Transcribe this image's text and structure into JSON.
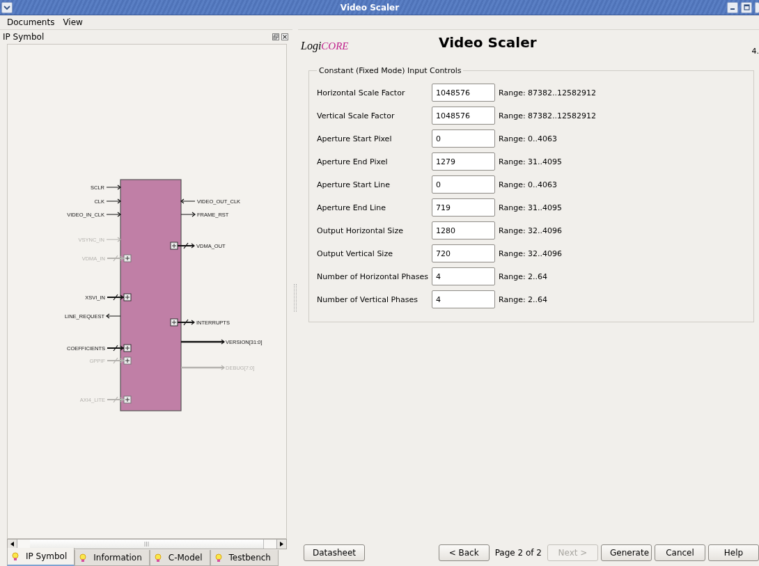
{
  "window": {
    "title": "Video Scaler"
  },
  "menu": [
    {
      "label": "Documents"
    },
    {
      "label": "View"
    }
  ],
  "left_panel": {
    "title": "IP Symbol",
    "symbol": {
      "left_pins": [
        {
          "label": "SCLR",
          "kind": "in",
          "disabled": false
        },
        {
          "label": "CLK",
          "kind": "in",
          "disabled": false
        },
        {
          "label": "VIDEO_IN_CLK",
          "kind": "in",
          "disabled": false
        },
        {
          "label": "VSYNC_IN",
          "kind": "in",
          "disabled": true
        },
        {
          "label": "VDMA_IN",
          "kind": "bus",
          "disabled": true
        },
        {
          "label": "XSVI_IN",
          "kind": "bus",
          "disabled": false
        },
        {
          "label": "LINE_REQUEST",
          "kind": "out",
          "disabled": false
        },
        {
          "label": "COEFFICIENTS",
          "kind": "bus",
          "disabled": false
        },
        {
          "label": "GPPIF",
          "kind": "bus",
          "disabled": true
        },
        {
          "label": "AXI4_LITE",
          "kind": "bus",
          "disabled": true
        }
      ],
      "right_pins": [
        {
          "label": "VIDEO_OUT_CLK",
          "kind": "in",
          "disabled": false
        },
        {
          "label": "FRAME_RST",
          "kind": "out",
          "disabled": false
        },
        {
          "label": "VDMA_OUT",
          "kind": "bus",
          "disabled": false
        },
        {
          "label": "INTERRUPTS",
          "kind": "bus",
          "disabled": false
        },
        {
          "label": "VERSION[31:0]",
          "kind": "wide",
          "disabled": false
        },
        {
          "label": "DEBUG[7:0]",
          "kind": "wide",
          "disabled": true
        }
      ]
    },
    "tabs": [
      {
        "label": "IP Symbol",
        "selected": true
      },
      {
        "label": "Information",
        "selected": false
      },
      {
        "label": "C-Model",
        "selected": false
      },
      {
        "label": "Testbench",
        "selected": false
      }
    ]
  },
  "header": {
    "logo": [
      "Logi",
      "CORE"
    ],
    "title": "Video Scaler",
    "version": "4."
  },
  "group": {
    "title": "Constant (Fixed Mode) Input Controls",
    "fields": [
      {
        "label": "Horizontal Scale Factor",
        "value": "1048576",
        "range": "Range: 87382..12582912"
      },
      {
        "label": "Vertical Scale Factor",
        "value": "1048576",
        "range": "Range: 87382..12582912"
      },
      {
        "label": "Aperture Start Pixel",
        "value": "0",
        "range": "Range: 0..4063"
      },
      {
        "label": "Aperture End Pixel",
        "value": "1279",
        "range": "Range: 31..4095"
      },
      {
        "label": "Aperture Start Line",
        "value": "0",
        "range": "Range: 0..4063"
      },
      {
        "label": "Aperture End Line",
        "value": "719",
        "range": "Range: 31..4095"
      },
      {
        "label": "Output Horizontal Size",
        "value": "1280",
        "range": "Range: 32..4096"
      },
      {
        "label": "Output Vertical Size",
        "value": "720",
        "range": "Range: 32..4096"
      },
      {
        "label": "Number of Horizontal Phases",
        "value": "4",
        "range": "Range: 2..64"
      },
      {
        "label": "Number of Vertical Phases",
        "value": "4",
        "range": "Range: 2..64"
      }
    ]
  },
  "footer": {
    "datasheet": {
      "label": "Datasheet",
      "disabled": false
    },
    "back": {
      "label": "< Back",
      "disabled": false
    },
    "page": "Page 2 of 2",
    "buttons": [
      {
        "label": "Next >",
        "disabled": true
      },
      {
        "label": "Generate",
        "disabled": false
      },
      {
        "label": "Cancel",
        "disabled": false
      },
      {
        "label": "Help",
        "disabled": false
      }
    ]
  }
}
